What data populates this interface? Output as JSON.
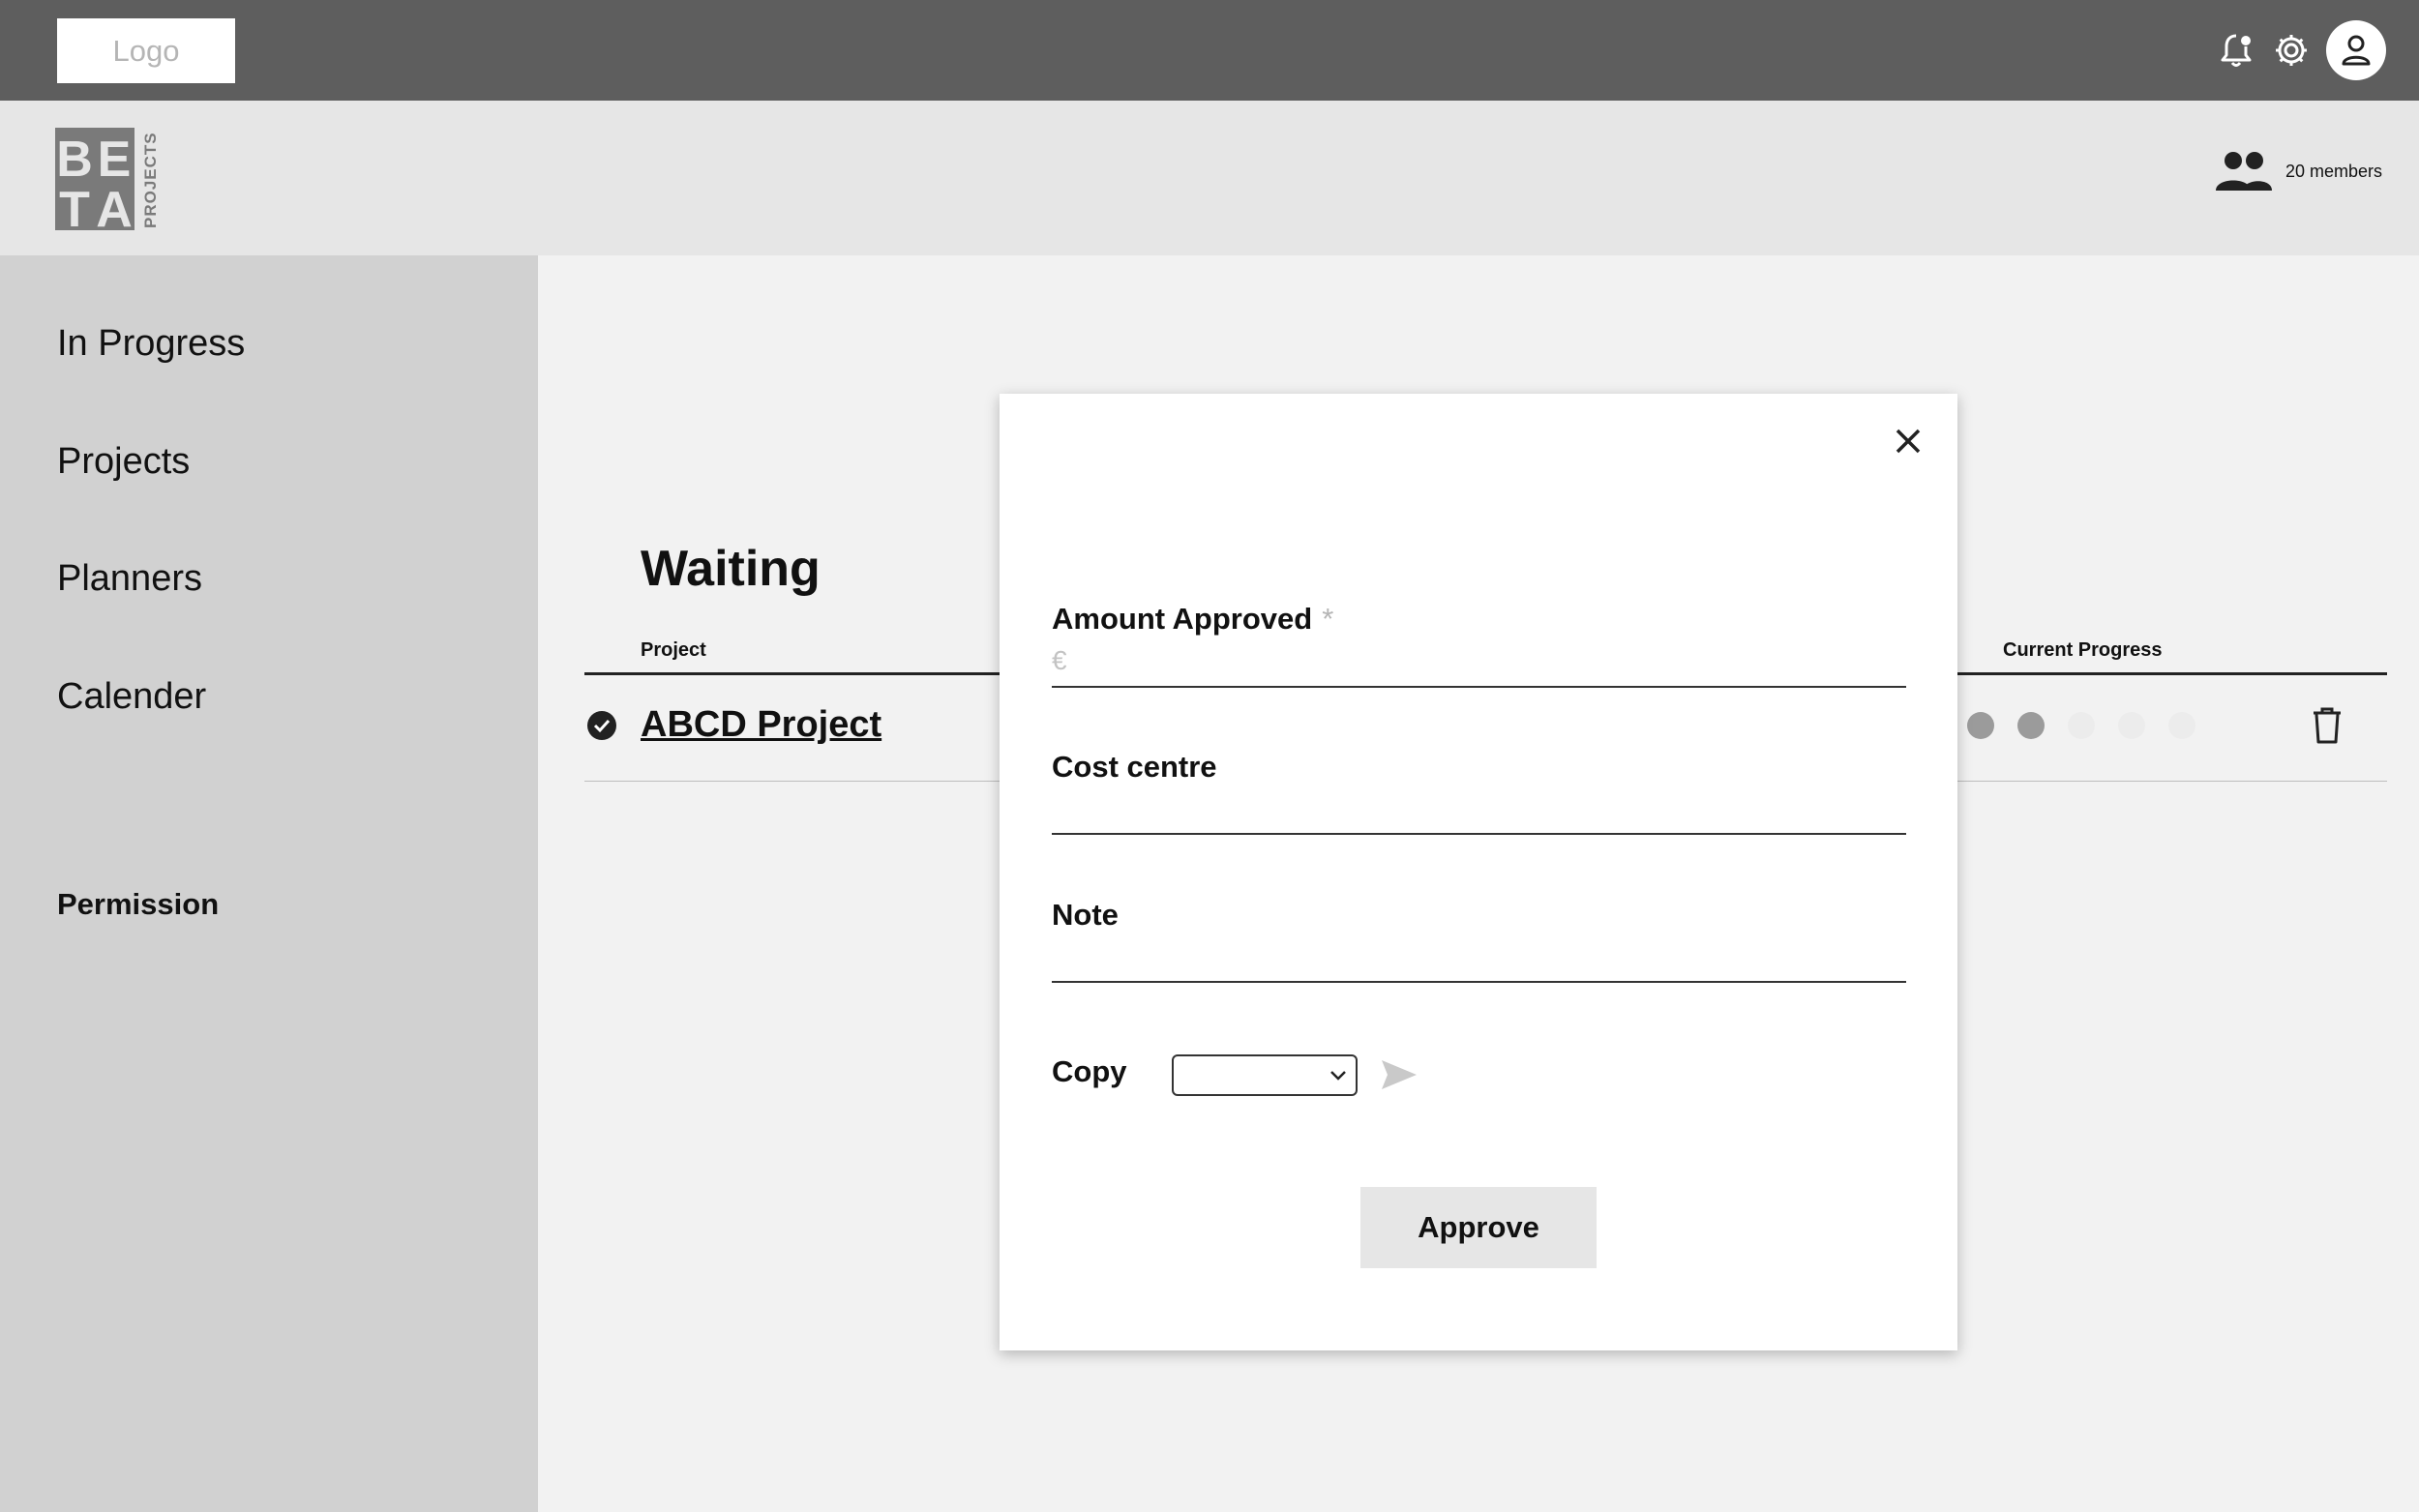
{
  "topbar": {
    "logo_text": "Logo",
    "icons": [
      "notification-bell-icon",
      "settings-gear-icon",
      "user-account-icon"
    ]
  },
  "subheader": {
    "brand_letters": [
      "B",
      "E",
      "T",
      "A"
    ],
    "brand_word": "PROJECTS",
    "members_icon": "group-people-icon",
    "members_text": "20 members"
  },
  "sidebar": {
    "items": [
      {
        "label": "In Progress"
      },
      {
        "label": "Projects"
      },
      {
        "label": "Planners"
      },
      {
        "label": "Calender"
      }
    ],
    "permission_label": "Permission"
  },
  "main": {
    "section_title": "Waiting",
    "columns": {
      "project": "Project",
      "current_progress": "Current Progress"
    },
    "rows": [
      {
        "project_name": "ABCD Project",
        "status_icon": "check-circle-icon",
        "progress": {
          "completed": 2,
          "total": 5
        },
        "action_icon": "trash-icon"
      }
    ]
  },
  "modal": {
    "close_icon": "close-icon",
    "fields": {
      "amount": {
        "label": "Amount Approved",
        "required_mark": "*",
        "prefix": "€",
        "value": ""
      },
      "cost_centre": {
        "label": "Cost centre",
        "value": ""
      },
      "note": {
        "label": "Note",
        "value": ""
      }
    },
    "copy": {
      "label": "Copy",
      "selected": ""
    },
    "approve_label": "Approve"
  },
  "colors": {
    "topbar_bg": "#5e5e5e",
    "subheader_bg": "#e6e6e6",
    "sidebar_bg": "#d1d1d1",
    "main_bg": "#f2f2f2",
    "progress_filled": "#9b9b9b",
    "progress_empty": "#ececec"
  }
}
